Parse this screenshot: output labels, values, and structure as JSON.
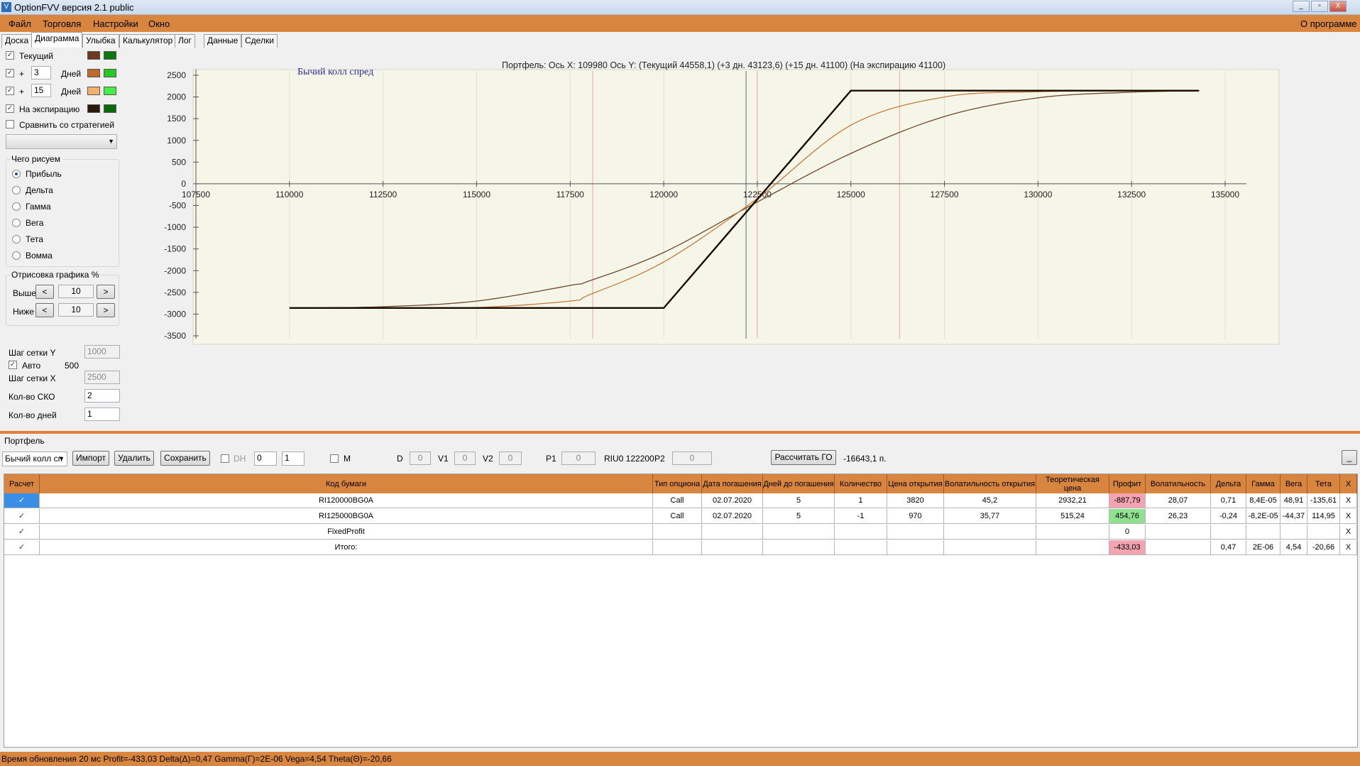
{
  "window": {
    "title": "OptionFVV версия 2.1 public",
    "minimize": "_",
    "maximize": "▫",
    "close": "X"
  },
  "menu": {
    "file": "Файл",
    "trading": "Торговля",
    "settings": "Настройки",
    "window": "Окно",
    "about": "О программе"
  },
  "tabs": [
    "Доска",
    "Диаграмма",
    "Улыбка",
    "Калькулятор",
    "Лог",
    "Данные",
    "Сделки"
  ],
  "left": {
    "current_label": "Текущий",
    "plus": "+",
    "days_label": "Дней",
    "days1": "3",
    "days2": "15",
    "expiry_label": "На экспирацию",
    "compare_label": "Сравнить со стратегией",
    "draw_group_title": "Чего рисуем",
    "draw_options": [
      "Прибыль",
      "Дельта",
      "Гамма",
      "Вега",
      "Тета",
      "Вомма"
    ],
    "render_group_title": "Отрисовка графика %",
    "above_label": "Выше",
    "above_value": "10",
    "below_label": "Ниже",
    "below_value": "10",
    "step_left": "<",
    "step_right": ">",
    "grid_y_label": "Шаг сетки Y",
    "grid_y_value": "1000",
    "auto_label": "Авто",
    "auto_value": "500",
    "grid_x_label": "Шаг сетки X",
    "grid_x_value": "2500",
    "sko_label": "Кол-во СКО",
    "sko_value": "2",
    "days_count_label": "Кол-во дней",
    "days_count_value": "1",
    "check_mark": "✓"
  },
  "colors": {
    "current_a": "#6b3a1f",
    "current_b": "#0a7a0a",
    "d3_a": "#c06a2a",
    "d3_b": "#22cc22",
    "d15_a": "#f0b070",
    "d15_b": "#44ee44",
    "exp_a": "#2a1a0a",
    "exp_b": "#0a6a0a",
    "accent": "#d8853f"
  },
  "chart_header": "Портфель: Ось X:  109980 Ось Y:   (Текущий 44558,1)  (+3 дн. 43123,6)  (+15 дн. 41100)  (На экспирацию 41100)",
  "chart_data": {
    "type": "line",
    "title": "Бычий колл спред",
    "xlim": [
      107500,
      135000
    ],
    "ylim": [
      -3500,
      2500
    ],
    "x_ticks": [
      "107500",
      "110000",
      "112500",
      "115000",
      "117500",
      "120000",
      "122500",
      "125000",
      "127500",
      "130000",
      "132500",
      "135000"
    ],
    "y_ticks": [
      "2500",
      "2000",
      "1500",
      "1000",
      "500",
      "0",
      "-500",
      "-1000",
      "-1500",
      "-2000",
      "-2500",
      "-3000",
      "-3500"
    ],
    "vlines": {
      "current_price": 122200,
      "sigma": [
        118100,
        122500,
        126300
      ]
    },
    "series": [
      {
        "color": "#6b4a2a",
        "x": [
          110000,
          112500,
          115000,
          117500,
          118000,
          120000,
          122500,
          125000,
          127500,
          130000,
          132500,
          134300
        ],
        "y": [
          -2860,
          -2830,
          -2700,
          -2340,
          -2240,
          -1580,
          -420,
          700,
          1550,
          1980,
          2110,
          2140
        ]
      },
      {
        "color": "#c67a3a",
        "x": [
          110000,
          112500,
          115000,
          117500,
          118000,
          120000,
          122500,
          125000,
          127500,
          130000,
          132500,
          134300
        ],
        "y": [
          -2860,
          -2860,
          -2850,
          -2700,
          -2560,
          -1800,
          -340,
          1350,
          2000,
          2120,
          2140,
          2145
        ]
      },
      {
        "color": "#1a0a00",
        "x": [
          110000,
          120000,
          125000,
          134300
        ],
        "y": [
          -2860,
          -2860,
          2145,
          2145
        ]
      }
    ]
  },
  "portfolio": {
    "label": "Портфель",
    "strategy": "Бычий колл сп",
    "import": "Импорт",
    "delete": "Удалить",
    "save": "Сохранить",
    "dh": "DH",
    "dh_v1": "0",
    "dh_v2": "1",
    "m": "M",
    "d": "D",
    "d_val": "0",
    "v1": "V1",
    "v1_val": "0",
    "v2": "V2",
    "v2_val": "0",
    "p1": "P1",
    "p1_val": "0",
    "riu": "RIU0 122200",
    "p2": "P2",
    "p2_val": "0",
    "calc_go": "Рассчитать ГО",
    "go_value": "-16643,1 п.",
    "collapse": "_"
  },
  "table": {
    "headers": [
      "Расчет",
      "Код бумаги",
      "Тип опциона",
      "Дата погашения",
      "Дней до погашения",
      "Количество",
      "Цена открытия",
      "Волатильность открытия",
      "Теоретическая цена",
      "Профит",
      "Волатильность",
      "Дельта",
      "Гамма",
      "Вега",
      "Тета",
      "X"
    ],
    "rows": [
      [
        "✓",
        "RI120000BG0A",
        "Call",
        "02.07.2020",
        "5",
        "1",
        "3820",
        "45,2",
        "2932,21",
        "-887,79",
        "28,07",
        "0,71",
        "8,4E-05",
        "48,91",
        "-135,61",
        "X"
      ],
      [
        "✓",
        "RI125000BG0A",
        "Call",
        "02.07.2020",
        "5",
        "-1",
        "970",
        "35,77",
        "515,24",
        "454,76",
        "26,23",
        "-0,24",
        "-8,2E-05",
        "-44,37",
        "114,95",
        "X"
      ],
      [
        "✓",
        "FixedProfit",
        "",
        "",
        "",
        "",
        "",
        "",
        "",
        "0",
        "",
        "",
        "",
        "",
        "",
        "X"
      ],
      [
        "✓",
        "Итого:",
        "",
        "",
        "",
        "",
        "",
        "",
        "",
        "-433,03",
        "",
        "0,47",
        "2E-06",
        "4,54",
        "-20,66",
        "X"
      ]
    ],
    "profit_colors": [
      "#f4a3b0",
      "#8fe08f",
      "#ffffff",
      "#f4a3b0"
    ]
  },
  "status": "Время обновления 20 мс  Profit=-433,03 Delta(Δ)=0,47 Gamma(Γ)=2E-06 Vega=4,54 Theta(Θ)=-20,66"
}
